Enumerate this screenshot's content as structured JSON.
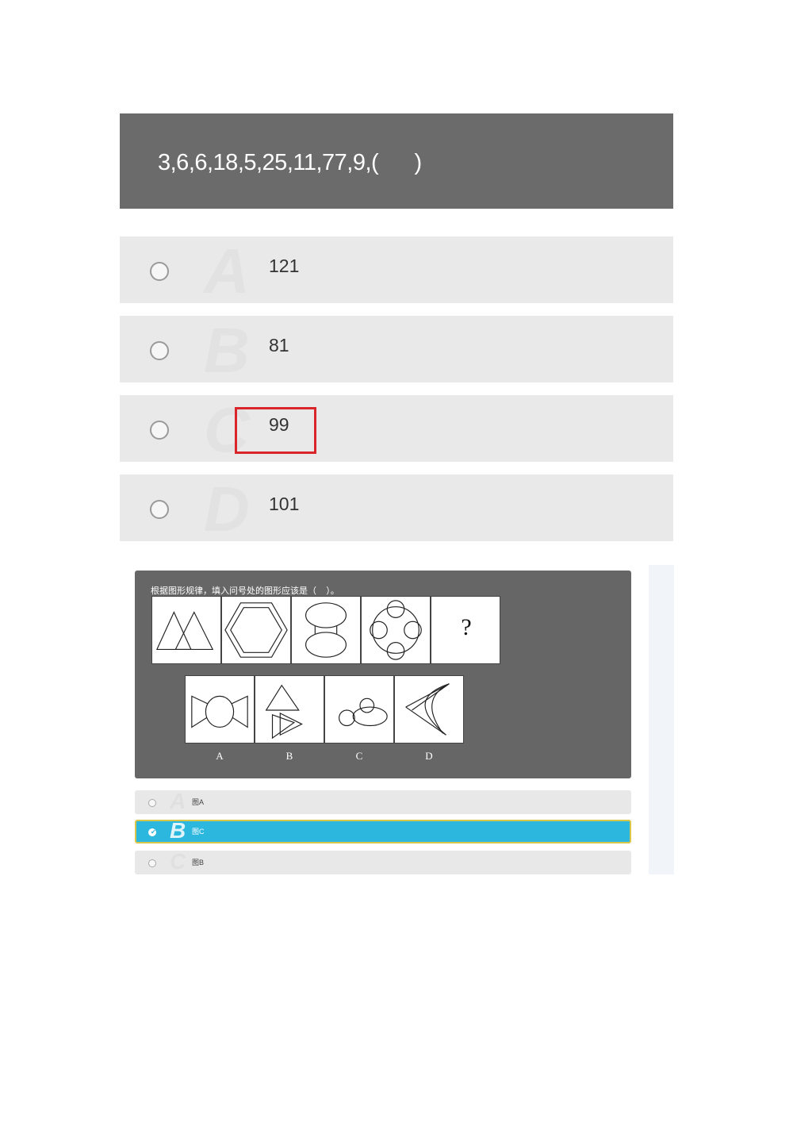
{
  "question1": {
    "text": "3,6,6,18,5,25,11,77,9,(      )",
    "options": [
      {
        "letter": "A",
        "value": "121"
      },
      {
        "letter": "B",
        "value": "81"
      },
      {
        "letter": "C",
        "value": "99",
        "highlighted": true
      },
      {
        "letter": "D",
        "value": "101"
      }
    ],
    "highlight_color": "#d8262b"
  },
  "question2": {
    "text": "根据图形规律，填入问号处的图形应该是（    ）。",
    "sequence_cells": [
      {
        "icon": "two-overlapping-triangles-icon"
      },
      {
        "icon": "hexagon-in-hexagon-icon"
      },
      {
        "icon": "two-ellipses-icon"
      },
      {
        "icon": "circle-with-four-circles-icon"
      },
      {
        "icon": "question-mark",
        "text": "?"
      }
    ],
    "answer_cells": [
      {
        "label": "A",
        "icon": "bowtie-circle-icon"
      },
      {
        "label": "B",
        "icon": "triangles-stack-icon"
      },
      {
        "label": "C",
        "icon": "circles-ellipse-icon"
      },
      {
        "label": "D",
        "icon": "crescent-lines-icon"
      }
    ],
    "options": [
      {
        "letter": "A",
        "text": "图A",
        "selected": false
      },
      {
        "letter": "B",
        "text": "图C",
        "selected": true
      },
      {
        "letter": "C",
        "text": "图B",
        "selected": false
      }
    ],
    "selected_color": "#2cb7df"
  }
}
